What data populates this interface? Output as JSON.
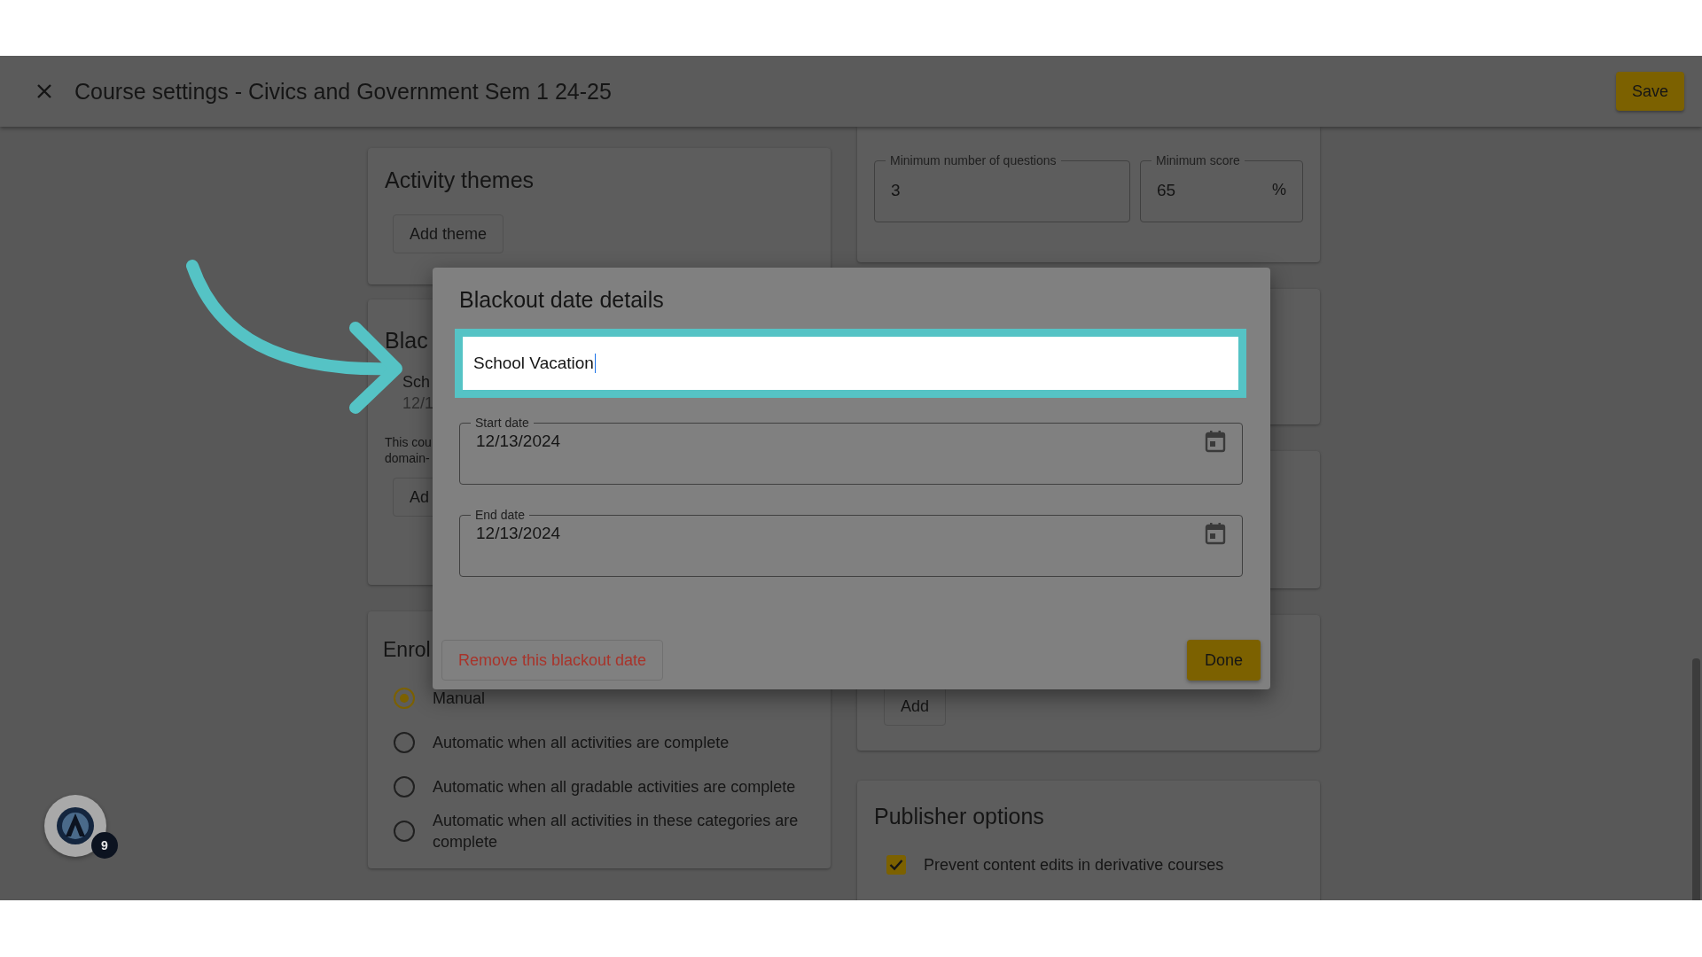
{
  "header": {
    "title": "Course settings - Civics and Government Sem 1 24-25",
    "save": "Save"
  },
  "activity_themes": {
    "title": "Activity themes",
    "button": "Add theme"
  },
  "blackout_card": {
    "title": "Blac",
    "item_name": "Sch",
    "item_date": "12/1",
    "note_lines": [
      "This cou",
      "domain-"
    ],
    "button": "Ad"
  },
  "enrollment": {
    "title": "Enrol",
    "options": [
      {
        "label": "Manual",
        "selected": true
      },
      {
        "label": "Automatic when all activities are complete",
        "selected": false
      },
      {
        "label": "Automatic when all gradable activities are complete",
        "selected": false
      },
      {
        "label": "Automatic when all activities in these categories are complete",
        "selected": false
      }
    ]
  },
  "mastery": {
    "fields": [
      {
        "label": "Minimum number of questions",
        "value": "3"
      },
      {
        "label": "Minimum score",
        "value": "65",
        "suffix": "%"
      }
    ]
  },
  "hidden_card": {
    "button": "Add"
  },
  "publisher_options": {
    "title": "Publisher options",
    "checkboxes": [
      {
        "label": "Prevent content edits in derivative courses",
        "checked": true
      }
    ]
  },
  "dialog": {
    "title": "Blackout date details",
    "name_value": "School Vacation",
    "date_fields": [
      {
        "label": "Start date",
        "value": "12/13/2024"
      },
      {
        "label": "End date",
        "value": "12/13/2024"
      }
    ],
    "remove_button": "Remove this blackout date",
    "done_button": "Done"
  },
  "help_badge": {
    "count": "9"
  }
}
